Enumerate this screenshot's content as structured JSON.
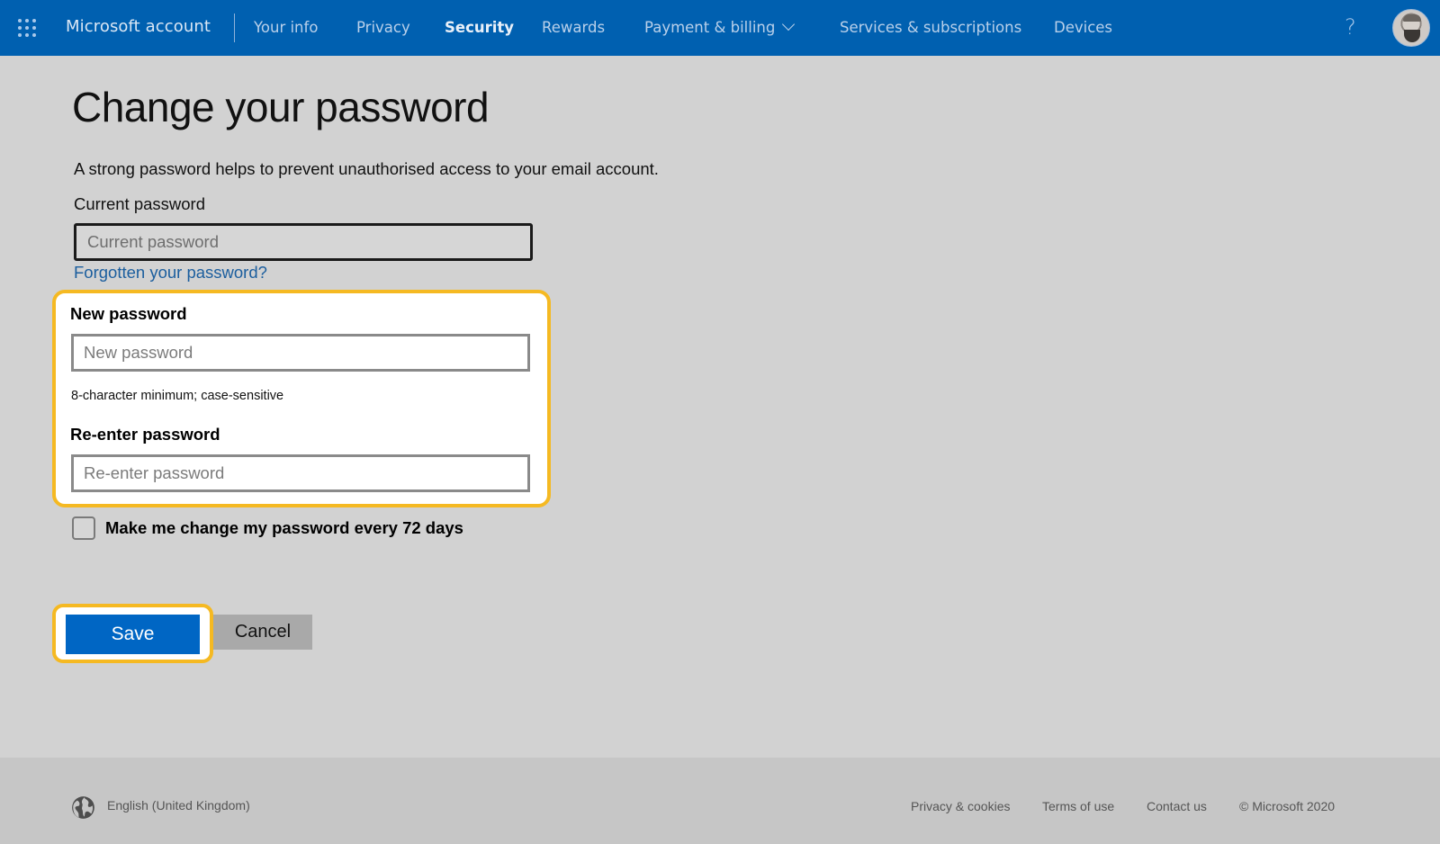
{
  "header": {
    "brand": "Microsoft account",
    "nav": [
      {
        "label": "Your info",
        "active": false
      },
      {
        "label": "Privacy",
        "active": false
      },
      {
        "label": "Security",
        "active": true
      },
      {
        "label": "Rewards",
        "active": false
      },
      {
        "label": "Payment & billing",
        "active": false,
        "has_dropdown": true
      },
      {
        "label": "Services & subscriptions",
        "active": false
      },
      {
        "label": "Devices",
        "active": false
      }
    ],
    "help_icon": "?",
    "icons": {
      "apps": "waffle-icon",
      "help": "help-icon",
      "avatar": "user-avatar"
    }
  },
  "main": {
    "title": "Change your password",
    "intro": "A strong password helps to prevent unauthorised access to your email account.",
    "current_password": {
      "label": "Current password",
      "value": "",
      "placeholder": "Current password"
    },
    "forgot_link": "Forgotten your password?",
    "new_password": {
      "label": "New password",
      "value": "",
      "placeholder": "New password",
      "hint": "8-character minimum; case-sensitive"
    },
    "reenter_password": {
      "label": "Re-enter password",
      "value": "",
      "placeholder": "Re-enter password"
    },
    "expiry_checkbox": {
      "label": "Make me change my password every 72 days",
      "checked": false
    },
    "save_label": "Save",
    "cancel_label": "Cancel"
  },
  "footer": {
    "locale": "English (United Kingdom)",
    "links": [
      "Privacy & cookies",
      "Terms of use",
      "Contact us"
    ],
    "copyright": "© Microsoft 2020"
  },
  "colors": {
    "header_bg": "#0060b0",
    "page_bg": "#d2d2d2",
    "highlight": "#f5b922",
    "primary_button": "#0066c4",
    "link": "#1b5e9e"
  }
}
